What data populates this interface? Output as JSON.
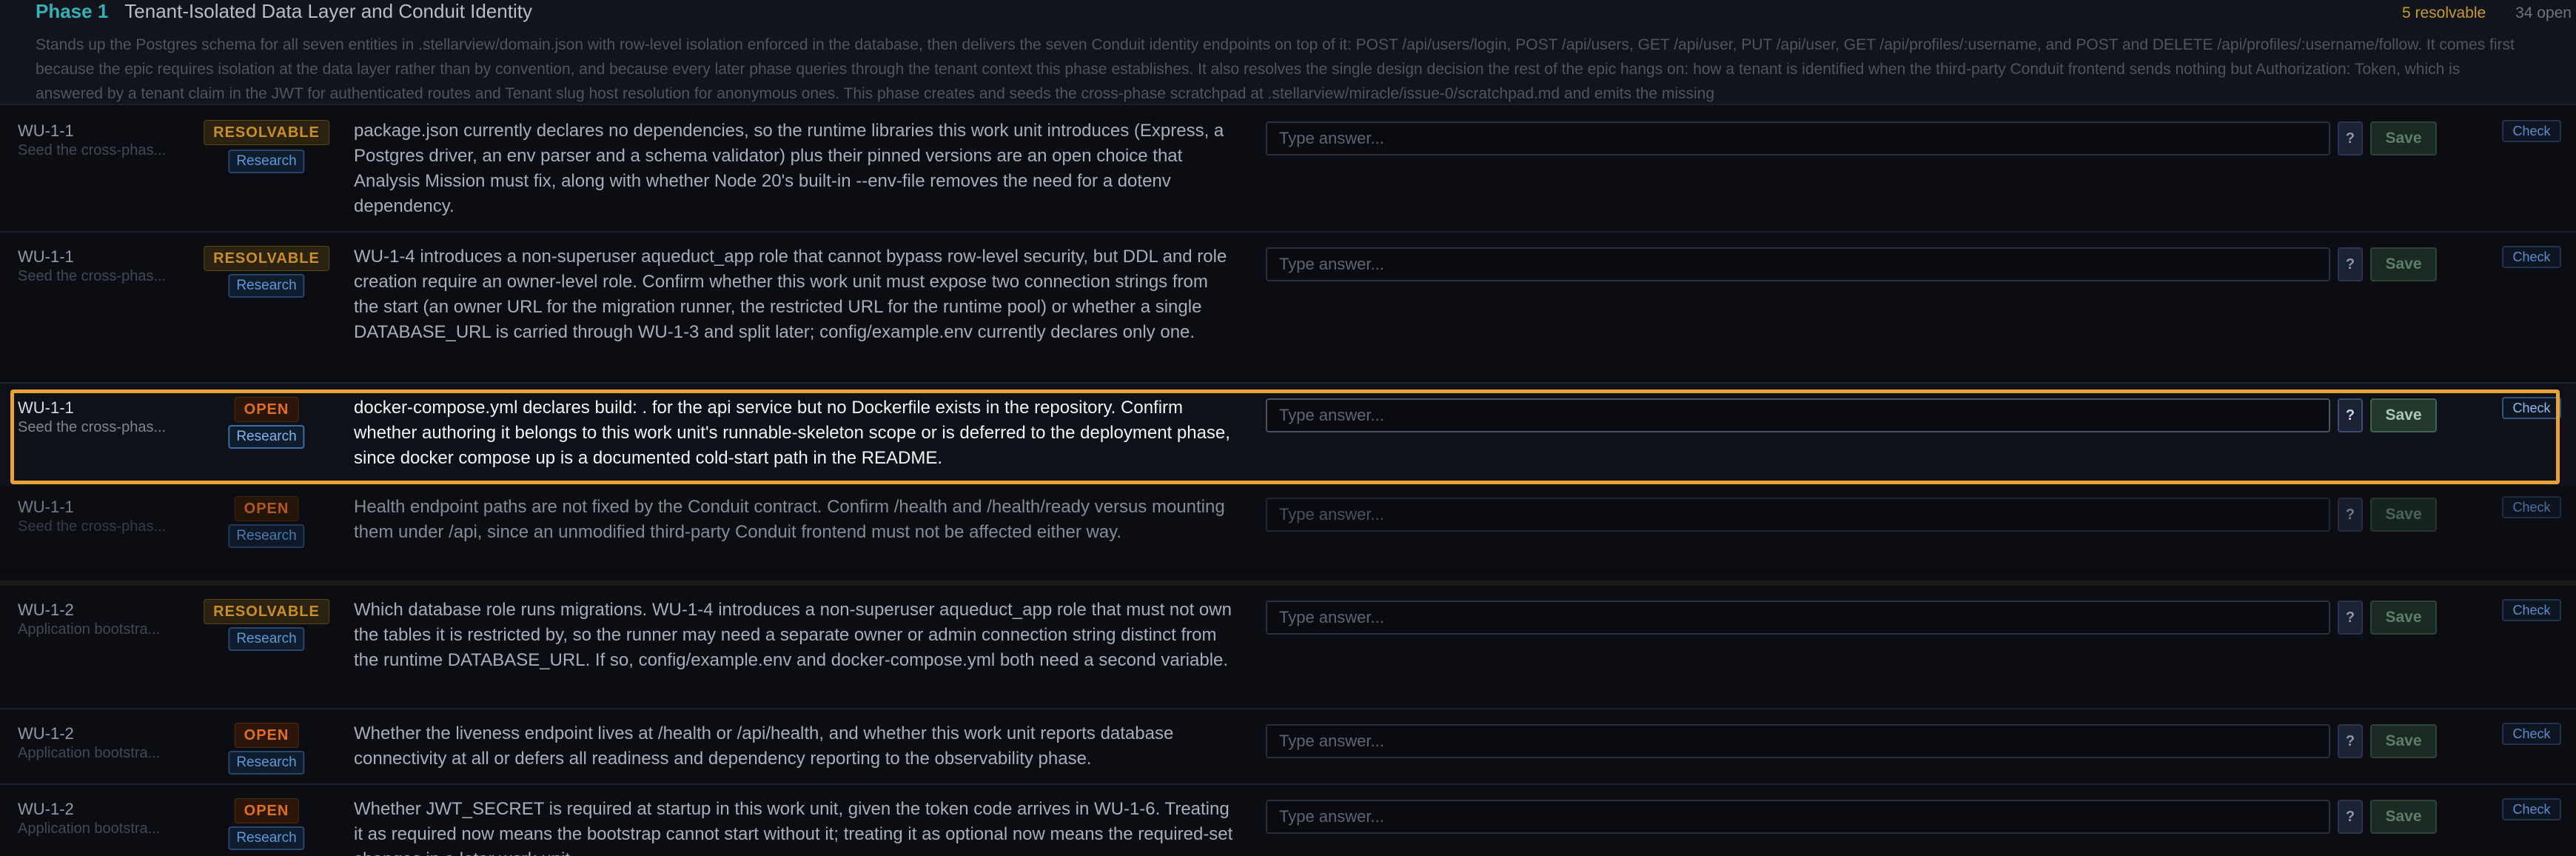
{
  "phase": {
    "number": "Phase 1",
    "title": "Tenant-Isolated Data Layer and Conduit Identity",
    "resolvable_count": "5 resolvable",
    "open_count": "34 open",
    "description": "Stands up the Postgres schema for all seven entities in .stellarview/domain.json with row-level isolation enforced in the database, then delivers the seven Conduit identity endpoints on top of it: POST /api/users/login, POST /api/users, GET /api/user, PUT /api/user, GET /api/profiles/:username, and POST and DELETE /api/profiles/:username/follow. It comes first because the epic requires isolation at the data layer rather than by convention, and because every later phase queries through the tenant context this phase establishes. It also resolves the single design decision the rest of the epic hangs on: how a tenant is identified when the third-party Conduit frontend sends nothing but Authorization: Token, which is answered by a tenant claim in the JWT for authenticated routes and Tenant slug host resolution for anonymous ones. This phase creates and seeds the cross-phase scratchpad at .stellarview/miracle/issue-0/scratchpad.md and emits the missing"
  },
  "labels": {
    "research": "Research",
    "answer_placeholder": "Type answer...",
    "help": "?",
    "save": "Save",
    "check": "Check"
  },
  "rows": [
    {
      "id": "WU-1-1",
      "subtitle": "Seed the cross-phas...",
      "status": "RESOLVABLE",
      "question": "package.json currently declares no dependencies, so the runtime libraries this work unit introduces (Express, a Postgres driver, an env parser and a schema validator) plus their pinned versions are an open choice that Analysis Mission must fix, along with whether Node 20's built-in --env-file removes the need for a dotenv dependency."
    },
    {
      "id": "WU-1-1",
      "subtitle": "Seed the cross-phas...",
      "status": "RESOLVABLE",
      "question": "WU-1-4 introduces a non-superuser aqueduct_app role that cannot bypass row-level security, but DDL and role creation require an owner-level role. Confirm whether this work unit must expose two connection strings from the start (an owner URL for the migration runner, the restricted URL for the runtime pool) or whether a single DATABASE_URL is carried through WU-1-3 and split later; config/example.env currently declares only one."
    },
    {
      "id": "WU-1-1",
      "subtitle": "Seed the cross-phas...",
      "status": "OPEN",
      "question": "docker-compose.yml declares build: . for the api service but no Dockerfile exists in the repository. Confirm whether authoring it belongs to this work unit's runnable-skeleton scope or is deferred to the deployment phase, since docker compose up is a documented cold-start path in the README."
    },
    {
      "id": "WU-1-1",
      "subtitle": "Seed the cross-phas...",
      "status": "OPEN",
      "question": "Health endpoint paths are not fixed by the Conduit contract. Confirm /health and /health/ready versus mounting them under /api, since an unmodified third-party Conduit frontend must not be affected either way."
    },
    {
      "id": "WU-1-2",
      "subtitle": "Application bootstra...",
      "status": "RESOLVABLE",
      "question": "Which database role runs migrations. WU-1-4 introduces a non-superuser aqueduct_app role that must not own the tables it is restricted by, so the runner may need a separate owner or admin connection string distinct from the runtime DATABASE_URL. If so, config/example.env and docker-compose.yml both need a second variable."
    },
    {
      "id": "WU-1-2",
      "subtitle": "Application bootstra...",
      "status": "OPEN",
      "question": "Whether the liveness endpoint lives at /health or /api/health, and whether this work unit reports database connectivity at all or defers all readiness and dependency reporting to the observability phase."
    },
    {
      "id": "WU-1-2",
      "subtitle": "Application bootstra...",
      "status": "OPEN",
      "question": "Whether JWT_SECRET is required at startup in this work unit, given the token code arrives in WU-1-6. Treating it as required now means the bootstrap cannot start without it; treating it as optional now means the required-set changes in a later work unit."
    }
  ]
}
